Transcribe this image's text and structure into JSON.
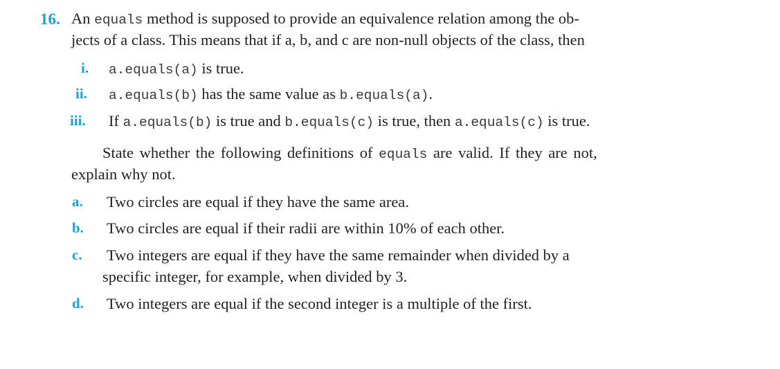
{
  "accent_color": "#1e9fd8",
  "exercise": {
    "number": "16.",
    "intro": {
      "line1": {
        "pre": "An ",
        "code": "equals",
        "post": " method is supposed to provide an equivalence relation among the ob-"
      },
      "line2": "jects of a class. This means that if a, b, and c are non-null objects of the class, then"
    },
    "properties": [
      {
        "label": "i.",
        "parts": [
          {
            "code": "a.equals(a)"
          },
          {
            "text": " is true."
          }
        ]
      },
      {
        "label": "ii.",
        "parts": [
          {
            "code": "a.equals(b)"
          },
          {
            "text": " has the same value as "
          },
          {
            "code": "b.equals(a)"
          },
          {
            "text": "."
          }
        ]
      },
      {
        "label": "iii.",
        "parts": [
          {
            "text": "If "
          },
          {
            "code": "a.equals(b)"
          },
          {
            "text": " is true and "
          },
          {
            "code": "b.equals(c)"
          },
          {
            "text": " is true, then "
          },
          {
            "code": "a.equals(c)"
          },
          {
            "text": " is true."
          }
        ]
      }
    ],
    "instruction": {
      "line1_pre": "State whether the following definitions of ",
      "line1_code": "equals",
      "line1_post": " are valid. If they are not,",
      "line2": "explain why not."
    },
    "definitions": [
      {
        "label": "a.",
        "lines": [
          "Two circles are equal if they have the same area."
        ]
      },
      {
        "label": "b.",
        "lines": [
          "Two circles are equal if their radii are within 10% of each other."
        ]
      },
      {
        "label": "c.",
        "lines": [
          "Two integers are equal if they have the same remainder when divided by a",
          "specific integer, for example, when divided by 3."
        ]
      },
      {
        "label": "d.",
        "lines": [
          "Two integers are equal if the second integer is a multiple of the first."
        ]
      }
    ]
  }
}
